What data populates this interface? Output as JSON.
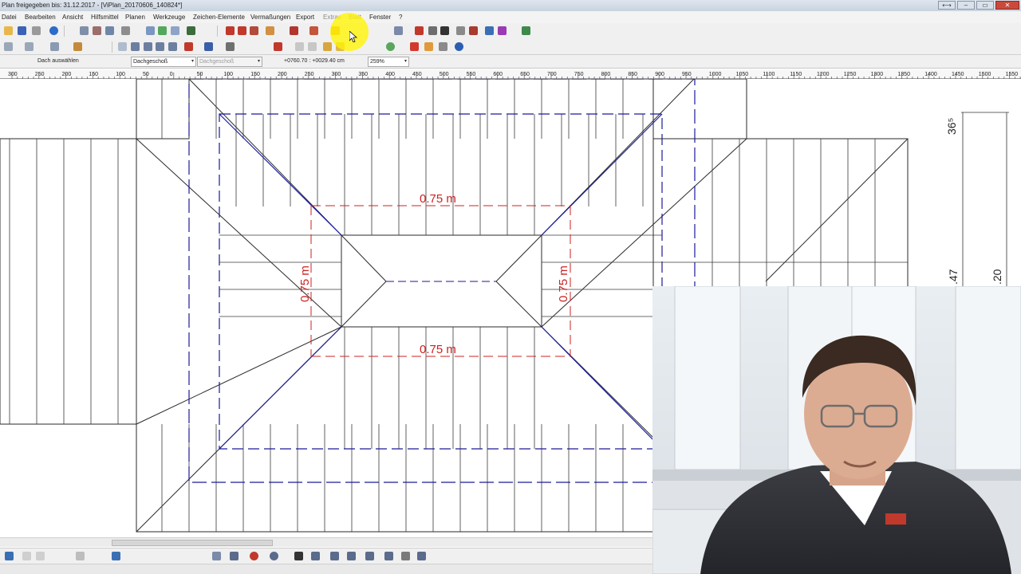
{
  "window": {
    "title": "Plan freigegeben bis: 31.12.2017 - [ViPlan_20170606_140824*]",
    "controls": [
      "⟷",
      "–",
      "▭",
      "✕"
    ]
  },
  "menu": {
    "items": [
      "Datei",
      "Bearbeiten",
      "Ansicht",
      "Hilfsmittel",
      "Planen",
      "Werkzeuge",
      "Zeichen-Elemente",
      "Vermaßungen",
      "Export",
      "Extras",
      "Blatt",
      "Fenster",
      "?"
    ]
  },
  "info_row": {
    "mode_label": "Dach auswählen",
    "floor_select": "Dachgeschoß",
    "floor_select_2": "Dachgeschoß",
    "coordinates": "+0760.70 : +0029.40 cm",
    "zoom": "259%"
  },
  "ruler": {
    "ticks": [
      "300",
      "250",
      "200",
      "150",
      "100",
      "50",
      "0",
      "50",
      "100",
      "150",
      "200",
      "250",
      "300",
      "350",
      "400",
      "450",
      "500",
      "550",
      "600",
      "650",
      "700",
      "750",
      "800",
      "850",
      "900",
      "950",
      "1000",
      "1050",
      "1100",
      "1150",
      "1200",
      "1250",
      "1300",
      "1350",
      "1400",
      "1450",
      "1500",
      "1550"
    ]
  },
  "drawing": {
    "dim_top": "0.75 m",
    "dim_bottom": "0.75 m",
    "dim_left": "0.75 m",
    "dim_right": "0.75 m",
    "side_dim_1": "36⁵",
    "side_dim_2": ".47",
    "side_dim_3": ".20"
  },
  "colors": {
    "dimension_red": "#cc2222",
    "roof_blue": "#1a1a99",
    "highlight_yellow": "#fff200"
  },
  "icons": {
    "toolbar1": [
      "new-icon",
      "open-icon",
      "save-icon",
      "print-icon",
      "info-icon",
      "zoom-icon",
      "hand-icon",
      "layer-icon",
      "red-tool-icon",
      "roof-icon",
      "wall-icon",
      "text-icon",
      "export-icon"
    ],
    "toolbar2": [
      "home-icon",
      "window-icon",
      "door-icon",
      "delete-icon",
      "euro-icon"
    ]
  }
}
